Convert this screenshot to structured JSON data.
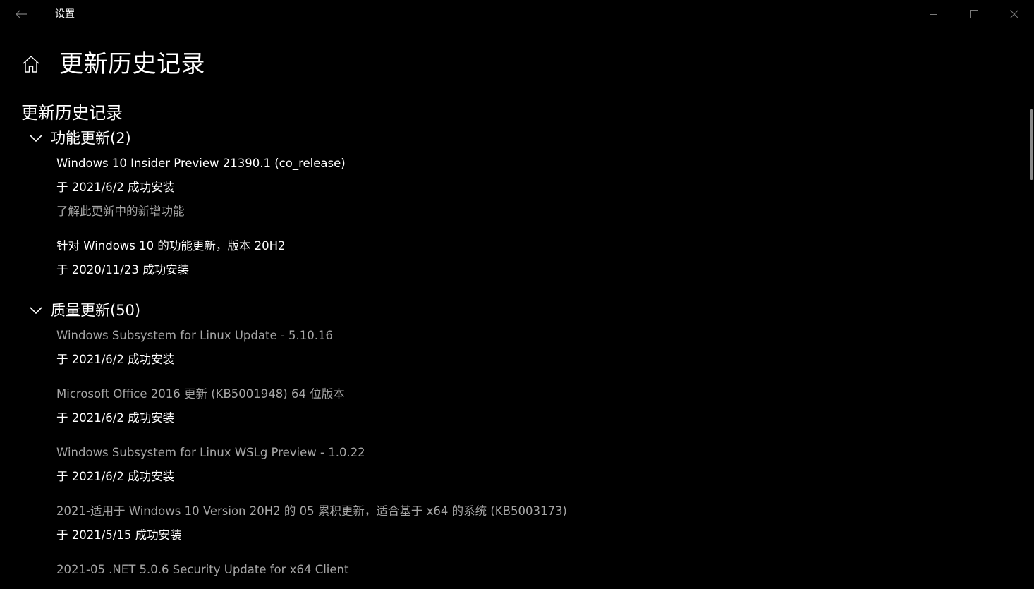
{
  "window": {
    "app_title": "设置",
    "controls": {
      "minimize": "minimize-icon",
      "maximize": "maximize-icon",
      "close": "close-icon"
    }
  },
  "header": {
    "page_title": "更新历史记录"
  },
  "section_title": "更新历史记录",
  "groups": [
    {
      "title": "功能更新(2)",
      "items": [
        {
          "name": "Windows 10 Insider Preview 21390.1 (co_release)",
          "status": "于 2021/6/2 成功安装",
          "link": "了解此更新中的新增功能"
        },
        {
          "name": "针对 Windows 10 的功能更新，版本 20H2",
          "status": "于 2020/11/23 成功安装"
        }
      ]
    },
    {
      "title": "质量更新(50)",
      "items": [
        {
          "name": "Windows Subsystem for Linux Update - 5.10.16",
          "status": "于 2021/6/2 成功安装"
        },
        {
          "name": "Microsoft Office 2016 更新 (KB5001948) 64 位版本",
          "status": "于 2021/6/2 成功安装"
        },
        {
          "name": "Windows Subsystem for Linux WSLg Preview - 1.0.22",
          "status": "于 2021/6/2 成功安装"
        },
        {
          "name": "2021-适用于 Windows 10 Version 20H2 的 05 累积更新，适合基于 x64 的系统 (KB5003173)",
          "status": "于 2021/5/15 成功安装"
        },
        {
          "name": "2021-05 .NET 5.0.6 Security Update for x64 Client"
        }
      ]
    }
  ],
  "colors": {
    "background": "#000000",
    "text": "#ffffff",
    "link_gray": "#a6a6a6"
  }
}
